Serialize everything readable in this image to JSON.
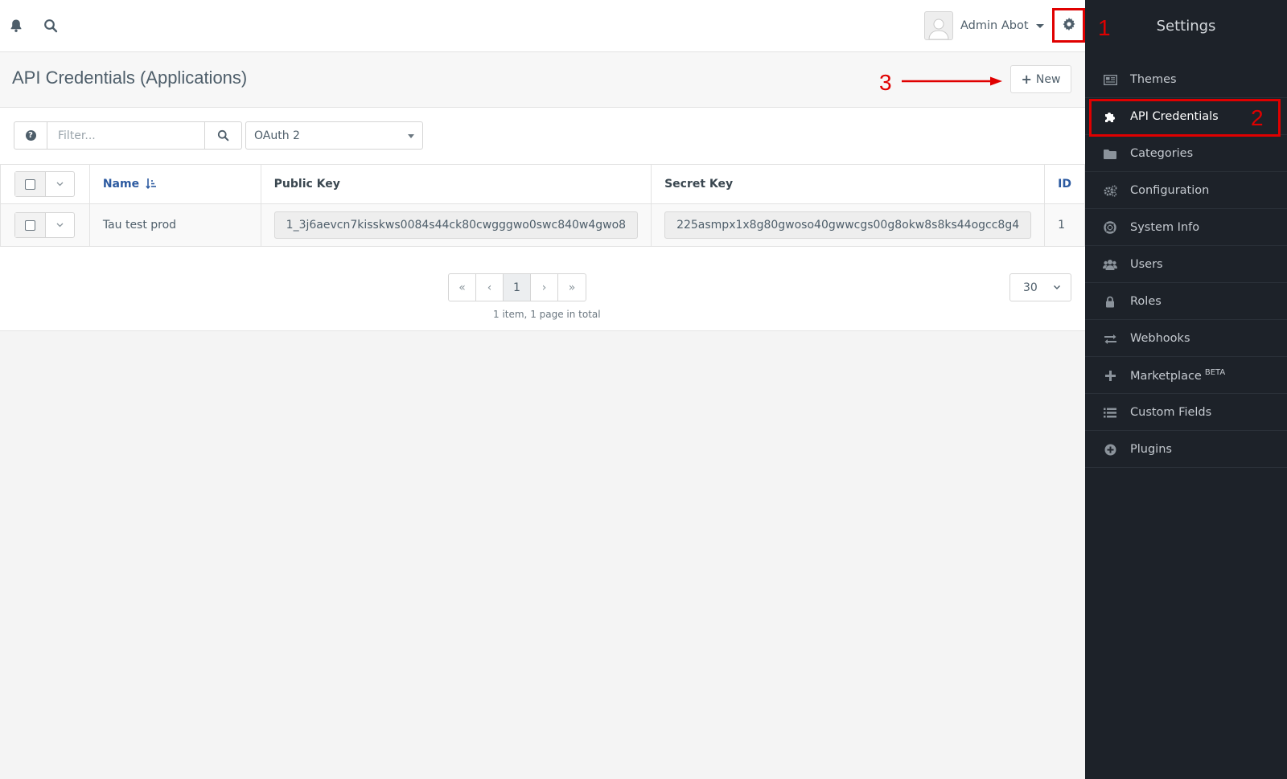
{
  "topbar": {
    "user_name": "Admin Abot"
  },
  "annotations": {
    "step1": "1",
    "step2": "2",
    "step3": "3"
  },
  "header": {
    "title": "API Credentials (Applications)",
    "new_label": "New"
  },
  "filter": {
    "placeholder": "Filter...",
    "type_selected": "OAuth 2"
  },
  "table": {
    "columns": {
      "name": "Name",
      "public_key": "Public Key",
      "secret_key": "Secret Key",
      "id": "ID"
    },
    "rows": [
      {
        "name": "Tau test prod",
        "public_key": "1_3j6aevcn7kisskws0084s44ck80cwgggwo0swc840w4gwo8",
        "secret_key": "225asmpx1x8g80gwoso40gwwcgs00g8okw8s8ks44ogcc8g4",
        "id": "1"
      }
    ]
  },
  "pagination": {
    "current_page": "1",
    "info": "1 item, 1 page in total",
    "per_page": "30"
  },
  "sidebar": {
    "title": "Settings",
    "items": [
      {
        "label": "Themes",
        "icon": "themes-icon"
      },
      {
        "label": "API Credentials",
        "icon": "puzzle-icon"
      },
      {
        "label": "Categories",
        "icon": "folder-icon"
      },
      {
        "label": "Configuration",
        "icon": "gears-icon"
      },
      {
        "label": "System Info",
        "icon": "lifebuoy-icon"
      },
      {
        "label": "Users",
        "icon": "users-icon"
      },
      {
        "label": "Roles",
        "icon": "lock-icon"
      },
      {
        "label": "Webhooks",
        "icon": "exchange-icon"
      },
      {
        "label": "Marketplace",
        "icon": "plus-icon",
        "badge": "BETA"
      },
      {
        "label": "Custom Fields",
        "icon": "list-icon"
      },
      {
        "label": "Plugins",
        "icon": "plus-circle-icon"
      }
    ]
  },
  "colors": {
    "sidebar_bg": "#1d2229",
    "annotation_red": "#e00000",
    "link_blue": "#2c5aa0"
  }
}
